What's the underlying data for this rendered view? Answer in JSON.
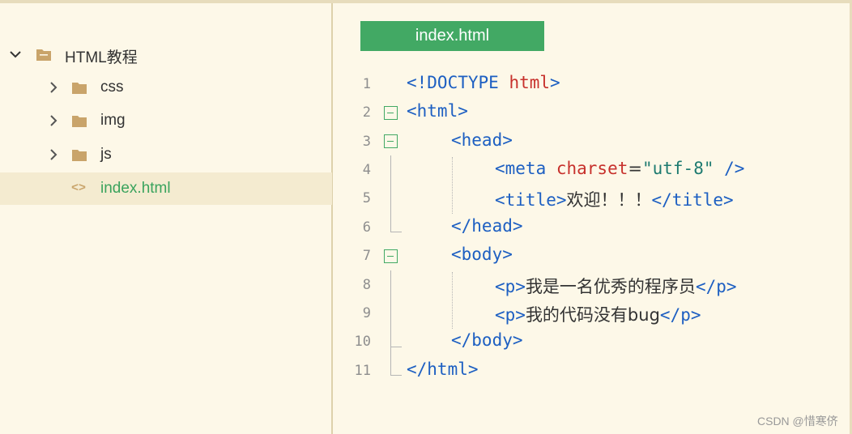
{
  "sidebar": {
    "root": {
      "label": "HTML教程",
      "icon": "folder-icon"
    },
    "items": [
      {
        "label": "css",
        "icon": "folder-icon"
      },
      {
        "label": "img",
        "icon": "folder-icon"
      },
      {
        "label": "js",
        "icon": "folder-icon"
      },
      {
        "label": "index.html",
        "icon": "code-file-icon",
        "glyph": "<>"
      }
    ]
  },
  "editor": {
    "tab": "index.html",
    "lines": [
      {
        "n": "1",
        "a": "<!DOCTYPE ",
        "b": "html",
        "c": ">"
      },
      {
        "n": "2",
        "a": "<html>"
      },
      {
        "n": "3",
        "a": "<head>"
      },
      {
        "n": "4",
        "a": "<meta ",
        "b": "charset",
        "c": "=",
        "d": "\"utf-8\"",
        "e": " />"
      },
      {
        "n": "5",
        "a": "<title>",
        "b": "欢迎！！！",
        "c": "</title>"
      },
      {
        "n": "6",
        "a": "</head>"
      },
      {
        "n": "7",
        "a": "<body>"
      },
      {
        "n": "8",
        "a": "<p>",
        "b": "我是一名优秀的程序员",
        "c": "</p>"
      },
      {
        "n": "9",
        "a": "<p>",
        "b": "我的代码没有bug",
        "c": "</p>"
      },
      {
        "n": "10",
        "a": "</body>"
      },
      {
        "n": "11",
        "a": "</html>"
      }
    ]
  },
  "watermark": "CSDN @惜寒侪",
  "colors": {
    "accent": "#42a964",
    "tag": "#1d5fc2",
    "attr": "#c7312c",
    "string": "#1d7a70",
    "background": "#fdf8e8"
  }
}
